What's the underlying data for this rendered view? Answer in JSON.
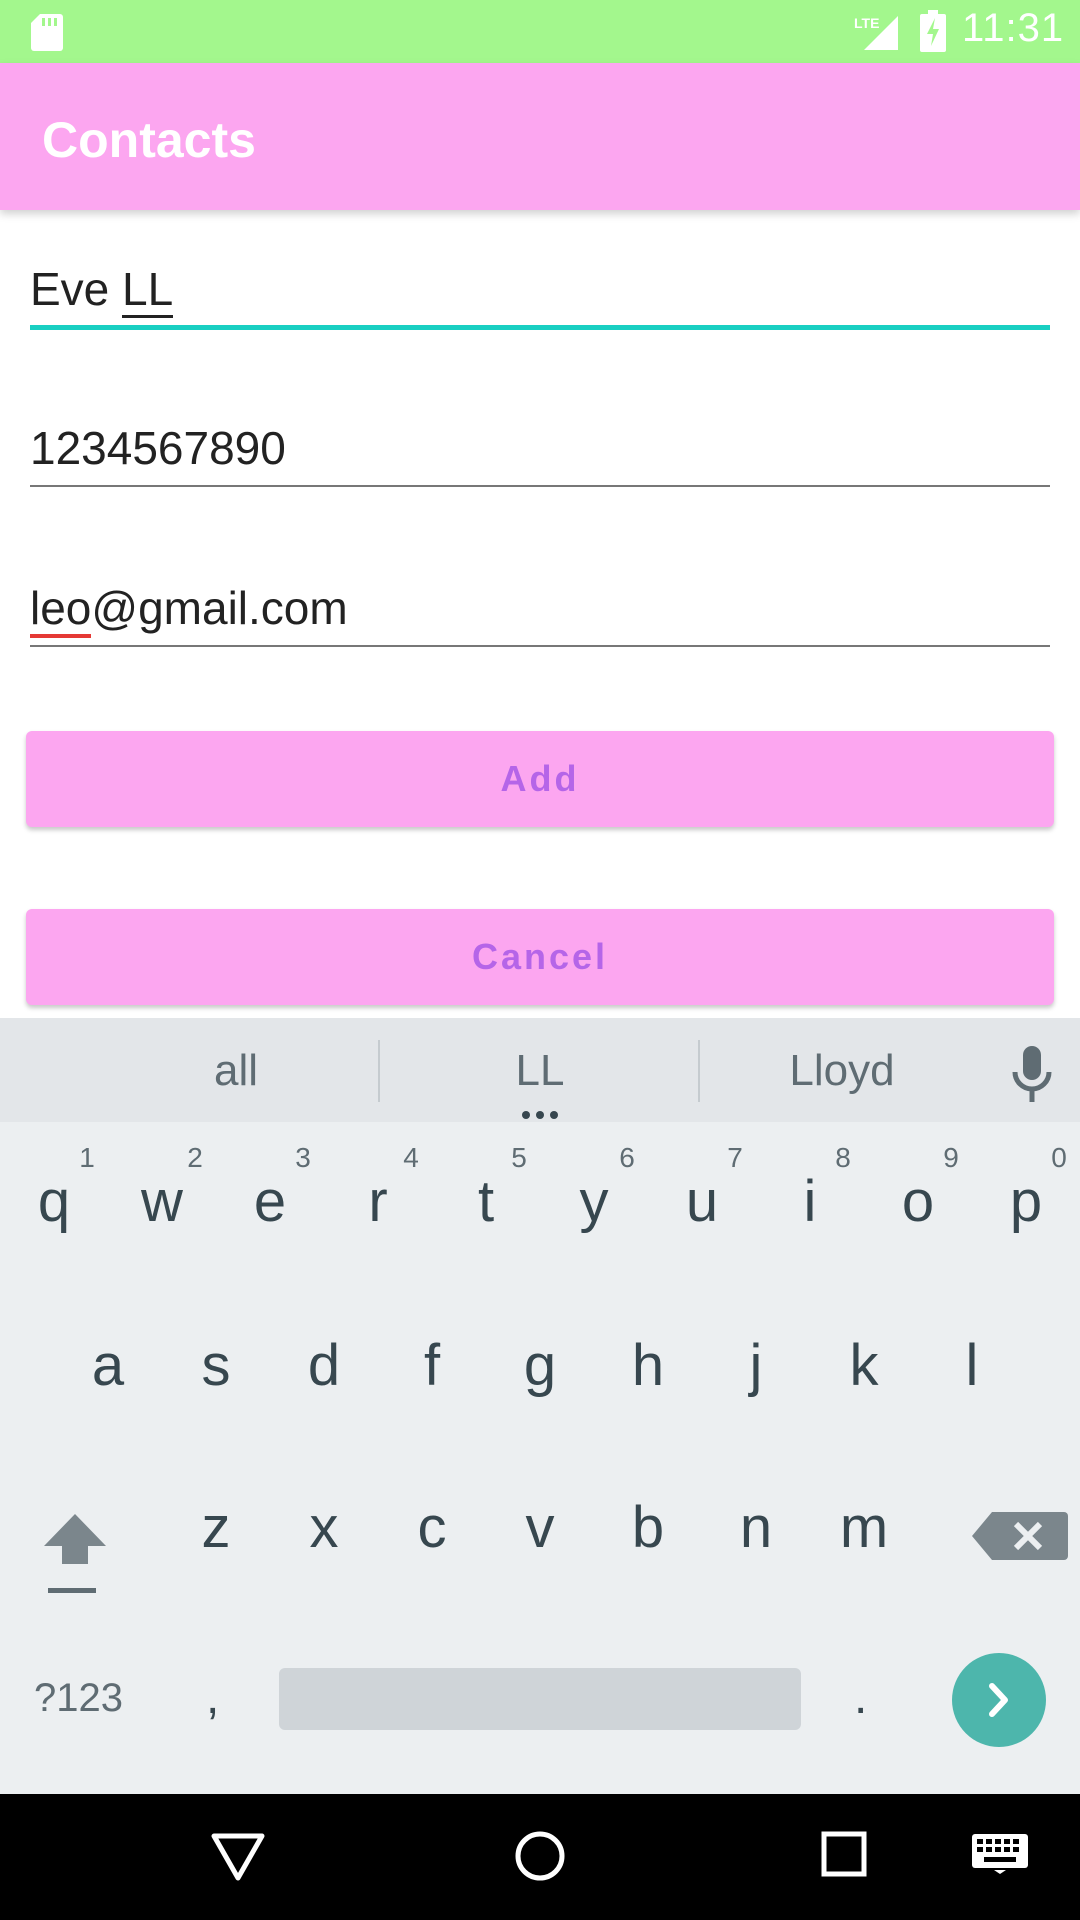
{
  "status_bar": {
    "time": "11:31",
    "network": "LTE"
  },
  "app_bar": {
    "title": "Contacts"
  },
  "form": {
    "name_first": "Eve",
    "name_composing": "LL",
    "phone": "1234567890",
    "email_misspelled": "leo",
    "email_rest": "@gmail.com",
    "add_label": "Add",
    "cancel_label": "Cancel"
  },
  "keyboard": {
    "suggestions": [
      "all",
      "LL",
      "Lloyd"
    ],
    "row1": [
      "q",
      "w",
      "e",
      "r",
      "t",
      "y",
      "u",
      "i",
      "o",
      "p"
    ],
    "row1_hints": [
      "1",
      "2",
      "3",
      "4",
      "5",
      "6",
      "7",
      "8",
      "9",
      "0"
    ],
    "row2": [
      "a",
      "s",
      "d",
      "f",
      "g",
      "h",
      "j",
      "k",
      "l"
    ],
    "row3": [
      "z",
      "x",
      "c",
      "v",
      "b",
      "n",
      "m"
    ],
    "symbols_label": "?123",
    "comma": ",",
    "period": "."
  },
  "colors": {
    "status_bar": "#a3f78d",
    "app_bar": "#fca6f0",
    "button_text": "#b565e8",
    "focus_line": "#19cfc2",
    "enter_key": "#4db6ac"
  },
  "icons": [
    "sd-card-icon",
    "lte-signal-icon",
    "battery-charging-icon",
    "mic-icon",
    "shift-icon",
    "backspace-icon",
    "enter-arrow-icon",
    "nav-back-icon",
    "nav-home-icon",
    "nav-recents-icon",
    "keyboard-icon"
  ]
}
